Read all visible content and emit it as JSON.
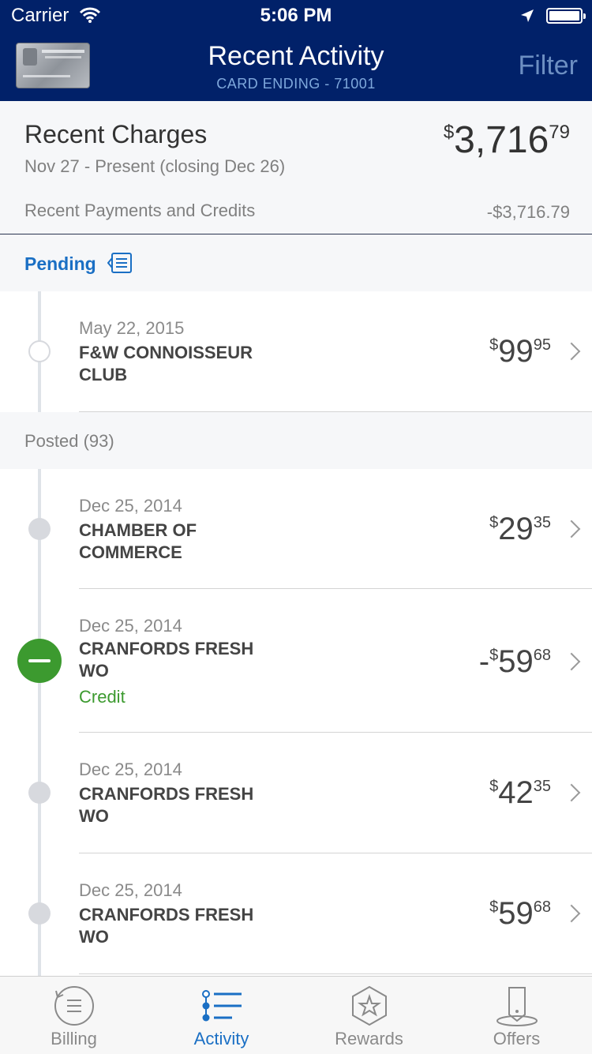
{
  "status_bar": {
    "carrier": "Carrier",
    "time": "5:06 PM"
  },
  "header": {
    "title": "Recent Activity",
    "subtitle": "CARD ENDING - 71001",
    "filter_label": "Filter"
  },
  "summary": {
    "title": "Recent Charges",
    "period": "Nov 27 - Present (closing Dec 26)",
    "amount_currency": "$",
    "amount_whole": "3,716",
    "amount_cents": "79",
    "payments_label": "Recent Payments and Credits",
    "payments_value": "-$3,716.79"
  },
  "pending": {
    "label": "Pending",
    "items": [
      {
        "date": "May 22, 2015",
        "merchant": "F&W CONNOISSEUR CLUB",
        "prefix": "",
        "currency": "$",
        "whole": "99",
        "cents": "95"
      }
    ]
  },
  "posted": {
    "label": "Posted (93)",
    "items": [
      {
        "date": "Dec 25, 2014",
        "merchant": "CHAMBER OF COMMERCE",
        "prefix": "",
        "currency": "$",
        "whole": "29",
        "cents": "35",
        "type": ""
      },
      {
        "date": "Dec 25, 2014",
        "merchant": "CRANFORDS FRESH WO",
        "prefix": "-",
        "currency": "$",
        "whole": "59",
        "cents": "68",
        "type": "Credit"
      },
      {
        "date": "Dec 25, 2014",
        "merchant": "CRANFORDS FRESH WO",
        "prefix": "",
        "currency": "$",
        "whole": "42",
        "cents": "35",
        "type": ""
      },
      {
        "date": "Dec 25, 2014",
        "merchant": "CRANFORDS FRESH WO",
        "prefix": "",
        "currency": "$",
        "whole": "59",
        "cents": "68",
        "type": ""
      }
    ]
  },
  "tabs": [
    {
      "label": "Billing",
      "icon": "billing-icon",
      "active": false
    },
    {
      "label": "Activity",
      "icon": "activity-icon",
      "active": true
    },
    {
      "label": "Rewards",
      "icon": "rewards-icon",
      "active": false
    },
    {
      "label": "Offers",
      "icon": "offers-icon",
      "active": false
    }
  ],
  "colors": {
    "nav_bg": "#012169",
    "accent_blue": "#1a6fc4",
    "credit_green": "#3c9a2f",
    "section_bg": "#f6f7f9"
  }
}
